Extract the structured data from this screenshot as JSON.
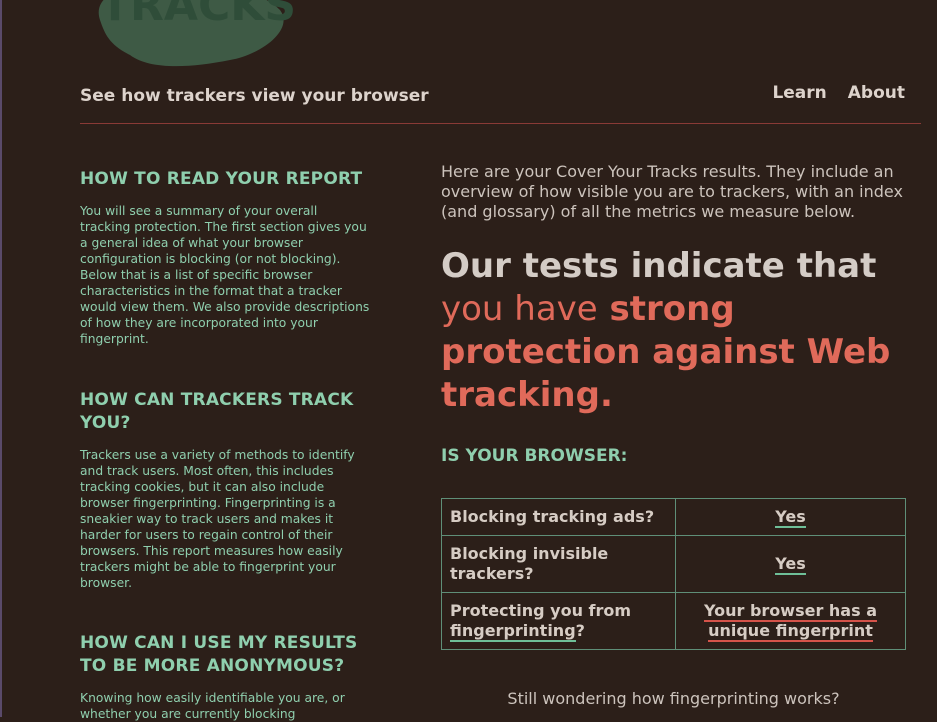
{
  "header": {
    "logo_text": "TRACKS",
    "tagline": "See how trackers view your browser",
    "nav": [
      {
        "label": "Learn"
      },
      {
        "label": "About"
      }
    ]
  },
  "sidebar": {
    "sections": [
      {
        "heading": "HOW TO READ YOUR REPORT",
        "body": "You will see a summary of your overall tracking protection. The first section gives you a general idea of what your browser configuration is blocking (or not blocking). Below that is a list of specific browser characteristics in the format that a tracker would view them. We also provide descriptions of how they are incorporated into your fingerprint."
      },
      {
        "heading": "HOW CAN TRACKERS TRACK YOU?",
        "body": "Trackers use a variety of methods to identify and track users. Most often, this includes tracking cookies, but it can also include browser fingerprinting. Fingerprinting is a sneakier way to track users and makes it harder for users to regain control of their browsers. This report measures how easily trackers might be able to fingerprint your browser."
      },
      {
        "heading": "HOW CAN I USE MY RESULTS TO BE MORE ANONYMOUS?",
        "body": "Knowing how easily identifiable you are, or whether you are currently blocking"
      }
    ]
  },
  "main": {
    "intro": "Here are your Cover Your Tracks results. They include an overview of how visible you are to trackers, with an index (and glossary) of all the metrics we measure below.",
    "verdict": {
      "prefix": "Our tests indicate that",
      "middle": "you have",
      "strong": "strong protection against Web tracking",
      "suffix": "."
    },
    "subhead": "IS YOUR BROWSER:",
    "results": [
      {
        "question": "Blocking tracking ads?",
        "answer": "Yes"
      },
      {
        "question": "Blocking invisible trackers?",
        "answer": "Yes"
      },
      {
        "question_prefix": "Protecting you from",
        "question_link": "fingerprinting",
        "question_suffix": "?",
        "answer": "Your browser has a unique fingerprint"
      }
    ],
    "footer_prompt": "Still wondering how fingerprinting works?"
  },
  "colors": {
    "background": "#2c1f19",
    "accent_green": "#8fcfae",
    "accent_red": "#e06a5a",
    "divider": "#8a3a36"
  }
}
